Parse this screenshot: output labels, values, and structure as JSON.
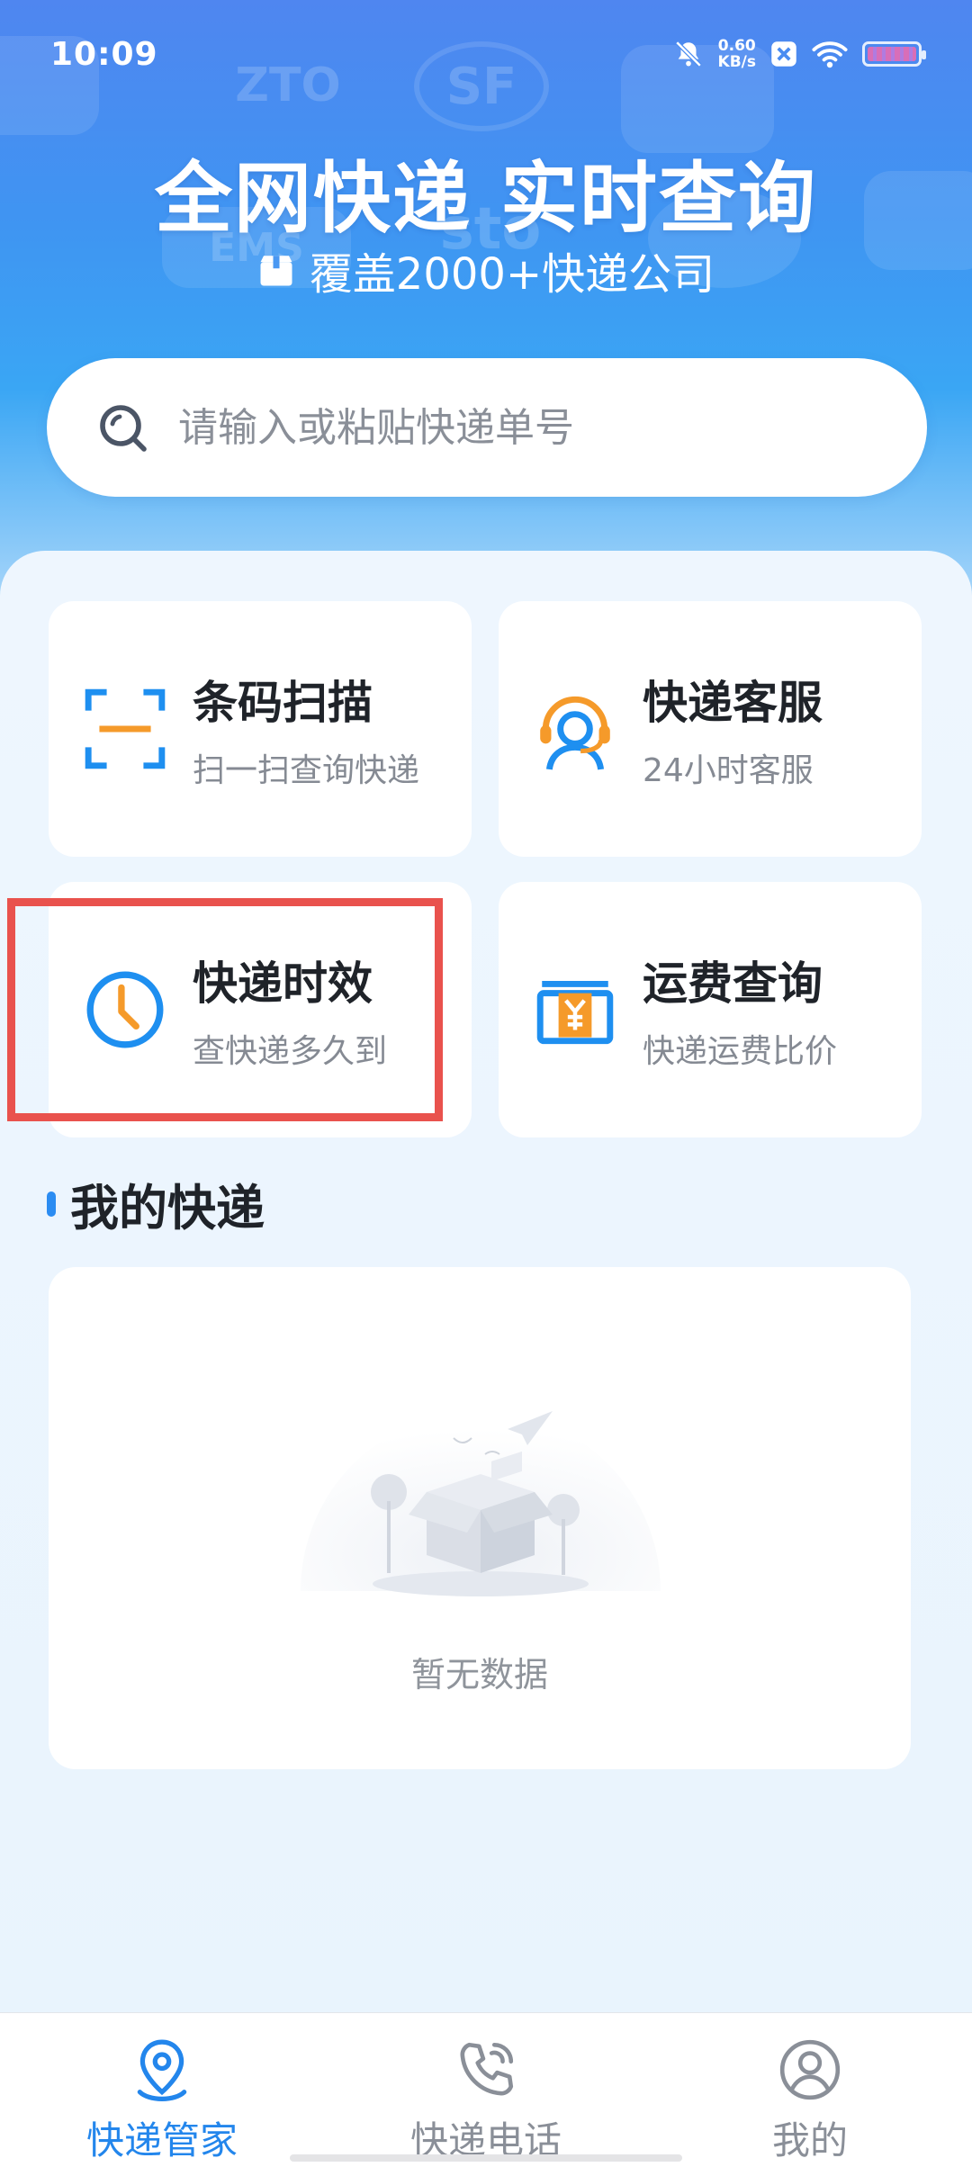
{
  "status_bar": {
    "time": "10:09",
    "net_speed_value": "0.60",
    "net_speed_unit": "KB/s",
    "icons": [
      "bell-muted-icon",
      "close-box-icon",
      "wifi-icon",
      "battery-icon"
    ]
  },
  "hero": {
    "title": "全网快递 实时查询",
    "subtitle": "覆盖2000+快递公司",
    "background_logos": [
      "ZTO",
      "SF",
      "EMS",
      "sto"
    ]
  },
  "search": {
    "placeholder": "请输入或粘贴快递单号",
    "icon": "search-icon"
  },
  "features": [
    {
      "title": "条码扫描",
      "subtitle": "扫一扫查询快递",
      "icon": "scan-icon"
    },
    {
      "title": "快递客服",
      "subtitle": "24小时客服",
      "icon": "headset-agent-icon"
    },
    {
      "title": "快递时效",
      "subtitle": "查快递多久到",
      "icon": "clock-icon"
    },
    {
      "title": "运费查询",
      "subtitle": "快递运费比价",
      "icon": "yen-box-icon"
    }
  ],
  "my_parcels": {
    "title": "我的快递",
    "empty_text": "暂无数据"
  },
  "bottom_nav": [
    {
      "label": "快递管家",
      "icon": "location-pin-icon",
      "active": true
    },
    {
      "label": "快递电话",
      "icon": "phone-icon",
      "active": false
    },
    {
      "label": "我的",
      "icon": "user-icon",
      "active": false
    }
  ],
  "colors": {
    "accent": "#2386ec",
    "highlight": "#e9524d",
    "orange": "#f59a2a"
  }
}
